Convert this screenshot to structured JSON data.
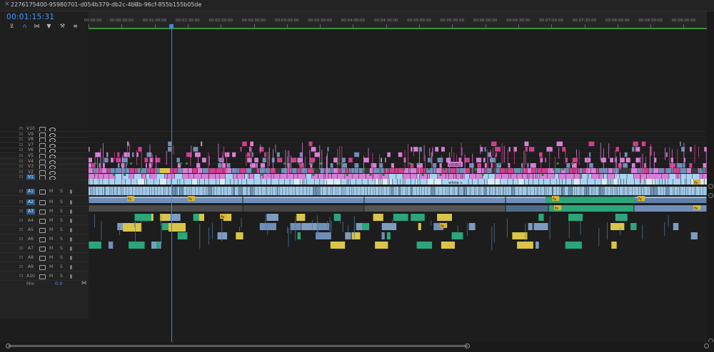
{
  "tab": {
    "title": "2276175400-95980701-d054b379-db2c-4bdb-96cf-855b155b05de",
    "close": "×",
    "menu": "≡"
  },
  "timecode": "00:01:15:31",
  "toolbar": [
    {
      "name": "snap-icon",
      "glyph": "⊻"
    },
    {
      "name": "magnet-icon",
      "glyph": "∩"
    },
    {
      "name": "linked-selection-icon",
      "glyph": "⋈"
    },
    {
      "name": "marker-icon",
      "glyph": "▼"
    },
    {
      "name": "wrench-icon",
      "glyph": "⚒"
    },
    {
      "name": "settings-icon",
      "glyph": "≡"
    }
  ],
  "ruler": [
    "00:00:00",
    "00:00:30:00",
    "00:01:00:00",
    "00:01:30:00",
    "00:02:00:00",
    "00:02:30:00",
    "00:03:00:00",
    "00:03:30:00",
    "00:04:00:00",
    "00:04:30:00",
    "00:05:00:00",
    "00:05:30:00",
    "00:06:00:00",
    "00:06:30:00",
    "00:07:00:00",
    "00:07:30:00",
    "00:08:00:00",
    "00:08:30:00",
    "00:09:00:00"
  ],
  "video_tracks": [
    "V10",
    "V9",
    "V8",
    "V7",
    "V6",
    "V5",
    "V4",
    "V3",
    "V2",
    "V1"
  ],
  "audio_tracks": [
    "A1",
    "A2",
    "A3",
    "A4",
    "A5",
    "A6",
    "A7",
    "A8",
    "A9",
    "A10"
  ],
  "mute_label": "M",
  "solo_label": "S",
  "mix": {
    "label": "Mix",
    "value": "0.0",
    "icon": "mix-end-icon"
  },
  "clip_labels": [
    "VIDEO",
    "white c",
    "fx"
  ],
  "colors": {
    "accent": "#3b8ad6",
    "clip_pink": "#d87fd8",
    "clip_magenta": "#cf3f8d",
    "clip_lightblue": "#a8d4f2",
    "clip_steel": "#6f8fb8",
    "clip_green": "#2aa67a",
    "clip_yellow": "#d9c54a",
    "clip_darkgray": "#3a3a3a",
    "ruler_green": "#3b8f3b"
  }
}
